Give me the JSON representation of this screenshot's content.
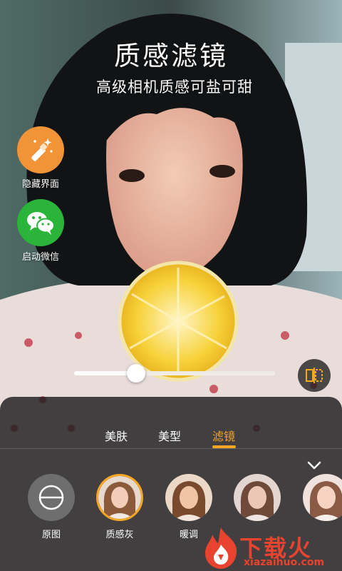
{
  "promo": {
    "title": "质感滤镜",
    "subtitle": "高级相机质感可盐可甜"
  },
  "side_buttons": [
    {
      "label": "隐藏界面",
      "icon": "magic-wand-icon",
      "color": "#f09437"
    },
    {
      "label": "启动微信",
      "icon": "wechat-icon",
      "color": "#2ab53a"
    }
  ],
  "slider": {
    "value": 0.31,
    "icon_right": "compare-icon"
  },
  "tabs": [
    {
      "label": "美肤",
      "active": false
    },
    {
      "label": "美型",
      "active": false
    },
    {
      "label": "滤镜",
      "active": true
    }
  ],
  "collapse_icon": "chevron-down-icon",
  "filters": [
    {
      "name": "原图",
      "icon": "no-filter-icon",
      "selected": false
    },
    {
      "name": "质感灰",
      "selected": true
    },
    {
      "name": "暖调",
      "selected": false
    },
    {
      "name": "",
      "selected": false
    },
    {
      "name": "",
      "selected": false
    }
  ],
  "watermark": {
    "text": "下载火",
    "url": "xiazaihuo.com"
  },
  "colors": {
    "accent": "#f5a623",
    "wechat": "#2ab53a",
    "hide": "#f09437",
    "watermark": "#e8432e"
  }
}
